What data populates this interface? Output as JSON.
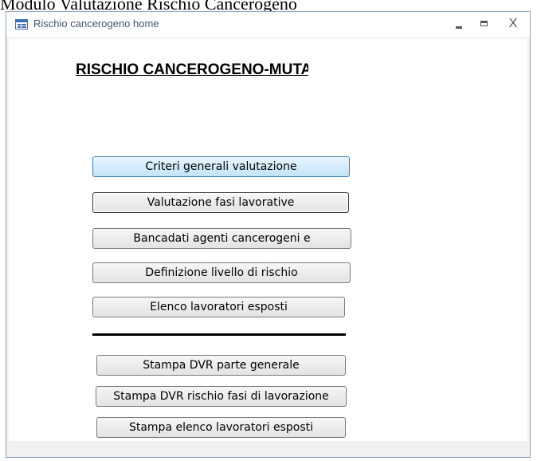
{
  "caption": "Modulo Valutazione Rischio Cancerogeno",
  "window": {
    "title": "Rischio cancerogeno home",
    "close_glyph": "X"
  },
  "form": {
    "heading": "RISCHIO CANCEROGENO-MUTAGENO",
    "buttons": {
      "criteri": "Criteri generali valutazione",
      "fasi": "Valutazione fasi lavorative",
      "bancadati": "Bancadati agenti cancerogeni e",
      "livello": "Definizione livello di rischio",
      "elenco": "Elenco lavoratori esposti",
      "stampa_generale": "Stampa DVR parte generale",
      "stampa_fasi": "Stampa DVR rischio  fasi di lavorazione",
      "stampa_elenco": "Stampa elenco lavoratori esposti"
    }
  },
  "icons": {
    "app": "access-form-icon",
    "minimize": "minimize-icon",
    "maximize": "maximize-icon",
    "close": "close-icon"
  },
  "colors": {
    "hover_button_top": "#e8f5fd",
    "hover_button_bottom": "#c2e4f7",
    "window_border": "#8ea3bd"
  }
}
